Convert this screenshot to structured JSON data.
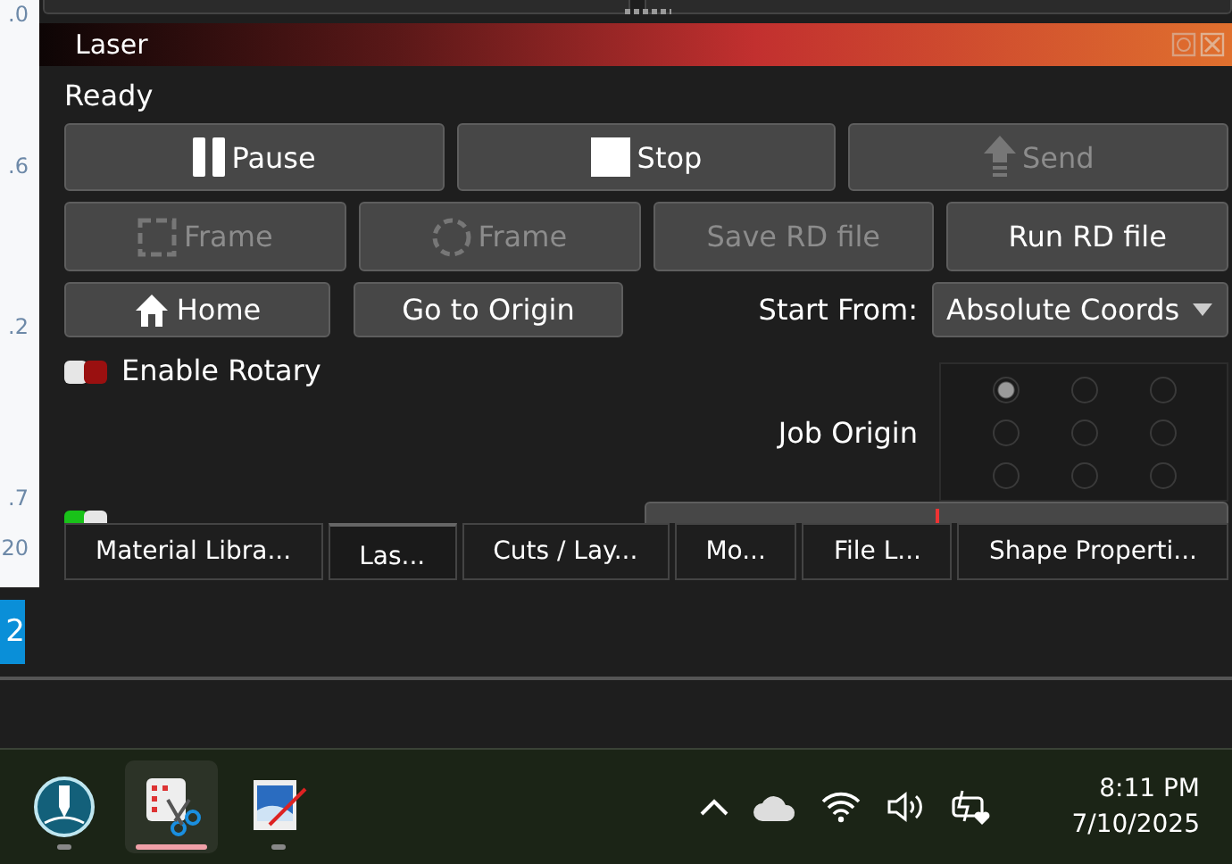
{
  "ruler": {
    "labels": [
      ".0",
      ".6",
      ".2",
      ".7",
      "20"
    ]
  },
  "panel": {
    "title": "Laser",
    "status": "Ready"
  },
  "button_rows": [
    [
      {
        "label": "Pause",
        "disabled": false
      },
      {
        "label": "Stop",
        "disabled": false
      },
      {
        "label": "Send",
        "disabled": true
      }
    ],
    [
      {
        "label": "Frame",
        "disabled": true
      },
      {
        "label": "Frame",
        "disabled": true
      },
      {
        "label": "Save RD file",
        "disabled": true
      },
      {
        "label": "Run RD file",
        "disabled": false
      }
    ]
  ],
  "position_row": {
    "home": "Home",
    "go_to_origin": "Go to Origin",
    "start_from_label": "Start From:",
    "start_from_value": "Absolute Coords"
  },
  "enable_rotary": {
    "label": "Enable Rotary",
    "checked": false
  },
  "job_origin": {
    "label": "Job Origin",
    "points": [
      {
        "selected": true
      },
      {
        "selected": false
      },
      {
        "selected": false
      },
      {
        "selected": false
      },
      {
        "selected": false
      },
      {
        "selected": false
      },
      {
        "selected": false
      },
      {
        "selected": false
      },
      {
        "selected": false
      }
    ]
  },
  "cut_selected": {
    "checked": true
  },
  "tabs": [
    {
      "label": "Material Libra...",
      "selected": false
    },
    {
      "label": "Las...",
      "selected": true
    },
    {
      "label": "Cuts / Lay...",
      "selected": false
    },
    {
      "label": "Mo...",
      "selected": false
    },
    {
      "label": "File L...",
      "selected": false
    },
    {
      "label": "Shape Properti...",
      "selected": false
    }
  ],
  "side_badge": "2",
  "taskbar": {
    "apps": [
      {
        "kind": "laser",
        "active": false
      },
      {
        "kind": "snip",
        "active": true
      },
      {
        "kind": "paint",
        "active": false
      }
    ],
    "time": "8:11 PM",
    "date": "7/10/2025"
  }
}
